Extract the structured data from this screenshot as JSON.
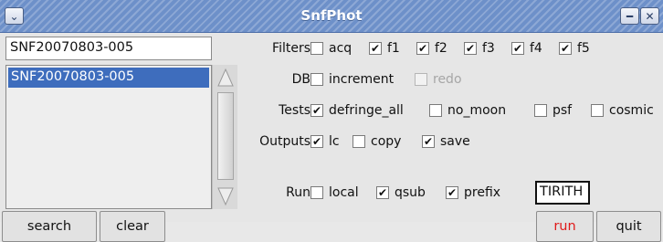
{
  "window": {
    "title": "SnfPhot",
    "menu_icon": "chevron-down-icon",
    "minimize_icon": "minimize-icon",
    "close_icon": "close-icon",
    "titlebar_color": "#6d90c9"
  },
  "file_entry": {
    "value": "SNF20070803-005"
  },
  "file_list": {
    "items": [
      {
        "label": "SNF20070803-005",
        "selected": true
      }
    ],
    "selection_color": "#3e6dbd"
  },
  "options": {
    "filters": {
      "label": "Filters",
      "items": [
        {
          "label": "acq",
          "checked": false
        },
        {
          "label": "f1",
          "checked": true
        },
        {
          "label": "f2",
          "checked": true
        },
        {
          "label": "f3",
          "checked": true
        },
        {
          "label": "f4",
          "checked": true
        },
        {
          "label": "f5",
          "checked": true
        }
      ]
    },
    "db": {
      "label": "DB",
      "items": [
        {
          "label": "increment",
          "checked": false
        },
        {
          "label": "redo",
          "checked": false,
          "disabled": true
        }
      ]
    },
    "tests": {
      "label": "Tests",
      "items": [
        {
          "label": "defringe_all",
          "checked": true
        },
        {
          "label": "no_moon",
          "checked": false
        },
        {
          "label": "psf",
          "checked": false
        },
        {
          "label": "cosmic",
          "checked": false
        }
      ]
    },
    "outputs": {
      "label": "Outputs",
      "items": [
        {
          "label": "lc",
          "checked": true
        },
        {
          "label": "copy",
          "checked": false
        },
        {
          "label": "save",
          "checked": true
        }
      ]
    },
    "run": {
      "label": "Run",
      "items": [
        {
          "label": "local",
          "checked": false
        },
        {
          "label": "qsub",
          "checked": true
        },
        {
          "label": "prefix",
          "checked": true
        }
      ],
      "prefix_value": "TIRITH"
    }
  },
  "buttons": {
    "search": "search",
    "clear": "clear",
    "run": "run",
    "quit": "quit",
    "run_color": "#e01a1a"
  }
}
